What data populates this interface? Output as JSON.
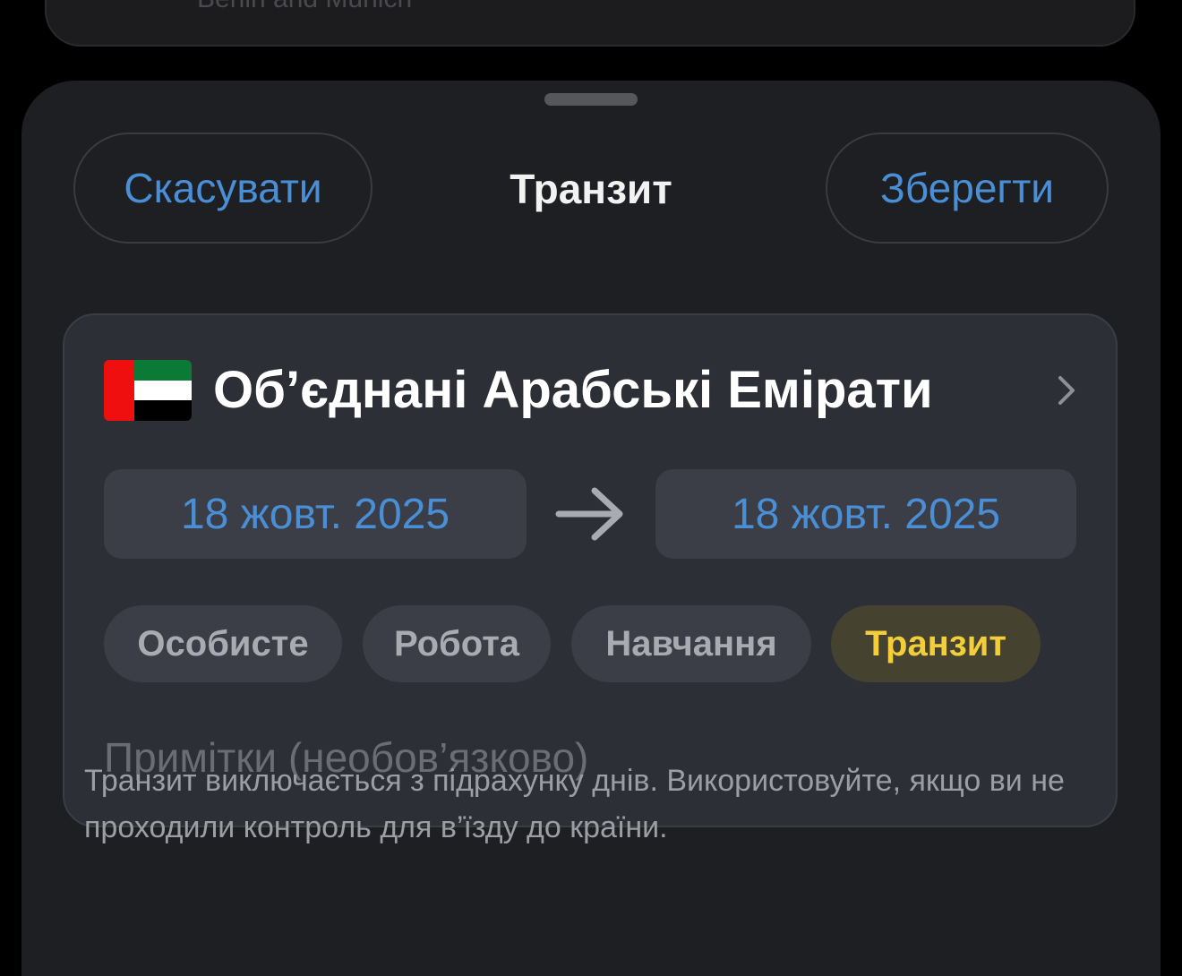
{
  "background_card": {
    "text": "Berlin and Munich"
  },
  "sheet": {
    "cancel_label": "Скасувати",
    "title": "Транзит",
    "save_label": "Зберегти",
    "accent_color": "#4a8fd6"
  },
  "trip": {
    "country": "Об’єднані Арабські Емірати",
    "flag_icon": "uae-flag-icon",
    "date_from": "18 жовт. 2025",
    "date_to": "18 жовт. 2025",
    "categories": [
      {
        "label": "Особисте",
        "selected": false
      },
      {
        "label": "Робота",
        "selected": false
      },
      {
        "label": "Навчання",
        "selected": false
      },
      {
        "label": "Транзит",
        "selected": true,
        "color": "#f2cf3a"
      }
    ],
    "notes_value": "",
    "notes_placeholder": "Примітки (необов’язково)"
  },
  "hint_text": "Транзит виключається з підрахунку днів. Використовуйте, якщо ви не проходили контроль для в’їзду до країни."
}
